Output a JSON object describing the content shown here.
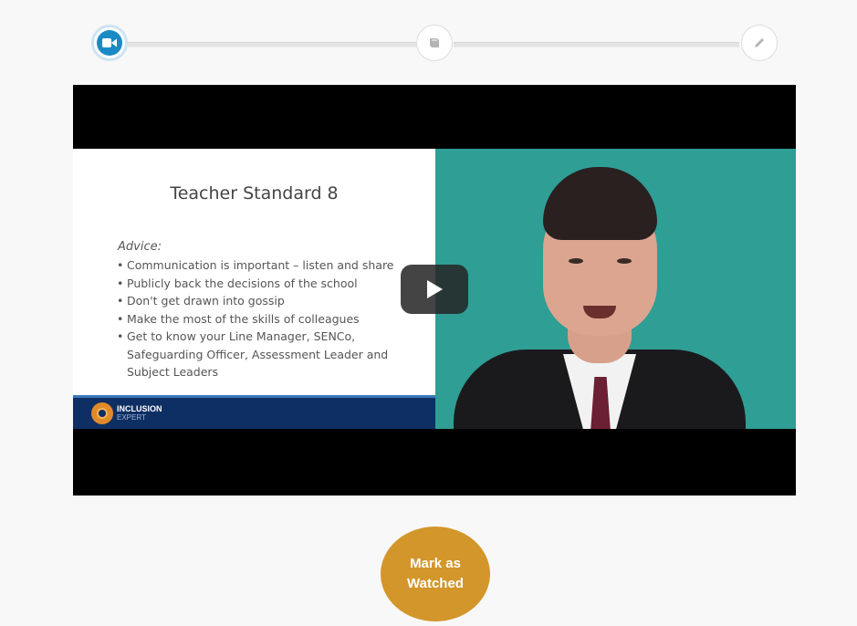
{
  "stepper": {
    "steps": [
      {
        "name": "video",
        "icon": "video-camera-icon",
        "state": "active"
      },
      {
        "name": "reading",
        "icon": "book-icon",
        "state": "inactive"
      },
      {
        "name": "quiz",
        "icon": "pencil-icon",
        "state": "inactive"
      }
    ],
    "active_color": "#1a8ac6"
  },
  "video": {
    "slide": {
      "title": "Teacher Standard 8",
      "advice_label": "Advice:",
      "bullets": [
        "Communication is important – listen and share",
        "Publicly back the decisions of the school",
        "Don't get drawn into gossip",
        "Make the most of the skills of colleagues",
        "Get to know your Line Manager, SENCo, Safeguarding Officer, Assessment Leader and Subject Leaders"
      ],
      "logo": {
        "line1": "INCLUSION",
        "line2": "EXPERT"
      }
    },
    "play_icon": "play-icon"
  },
  "actions": {
    "mark_watched_label": "Mark as Watched",
    "mark_watched_color": "#d3962a"
  }
}
